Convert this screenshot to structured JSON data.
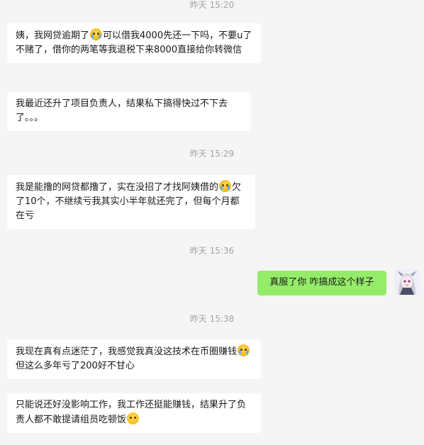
{
  "timestamps": [
    "昨天 15:20",
    "昨天 15:29",
    "昨天 15:36",
    "昨天 15:38"
  ],
  "messages": {
    "m1": {
      "a": "姨，我网贷逾期了",
      "b": "可以借我4000先还一下吗，不要u了不赌了，借你的两笔等我退税下来8000直接给你转微信",
      "emoji": "crying-face"
    },
    "m2": {
      "a": "我最近还升了项目负责人，结果私下搞得快过不下去了。。。"
    },
    "m3": {
      "a": "我是能撸的网贷都撸了，实在没招了才找阿姨借的",
      "b": "欠了10个，不继续亏我其实小半年就还完了，但每个月都在亏",
      "emoji": "crying-face"
    },
    "m4": {
      "a": "真服了你 咋搞成这个样子"
    },
    "m5": {
      "a": "我现在真有点迷茫了，我感觉我真没这技术在币圈赚钱",
      "b": "但这么多年亏了200好不甘心",
      "emoji": "crying-face"
    },
    "m6": {
      "a": "只能说还好没影响工作，我工作还挺能赚钱，结果升了负责人都不敢提请组员吃顿饭",
      "emoji": "sad-face"
    }
  },
  "colors": {
    "background": "#f5f5f5",
    "incoming_bubble": "#ffffff",
    "outgoing_bubble": "#95ec69"
  }
}
